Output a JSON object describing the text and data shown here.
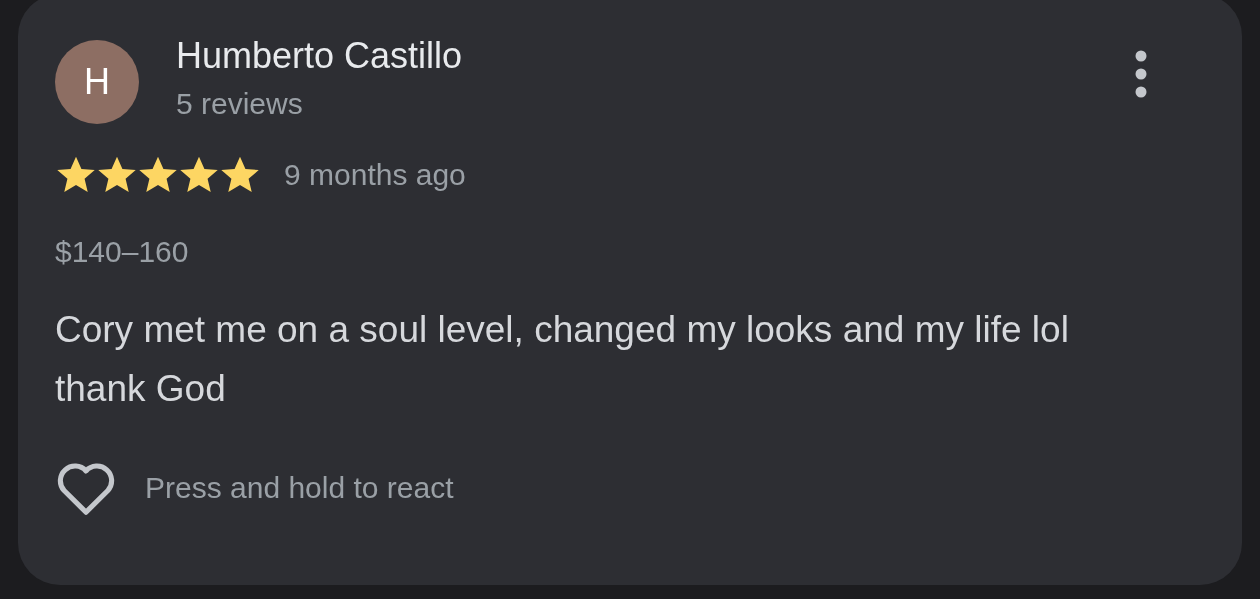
{
  "review": {
    "avatar_initial": "H",
    "author": "Humberto Castillo",
    "author_meta": "5 reviews",
    "stars": 5,
    "time": "9 months ago",
    "price": "$140–160",
    "text": "Cory met me on a soul level, changed my looks and my life lol thank God",
    "react_hint": "Press and hold to react"
  }
}
